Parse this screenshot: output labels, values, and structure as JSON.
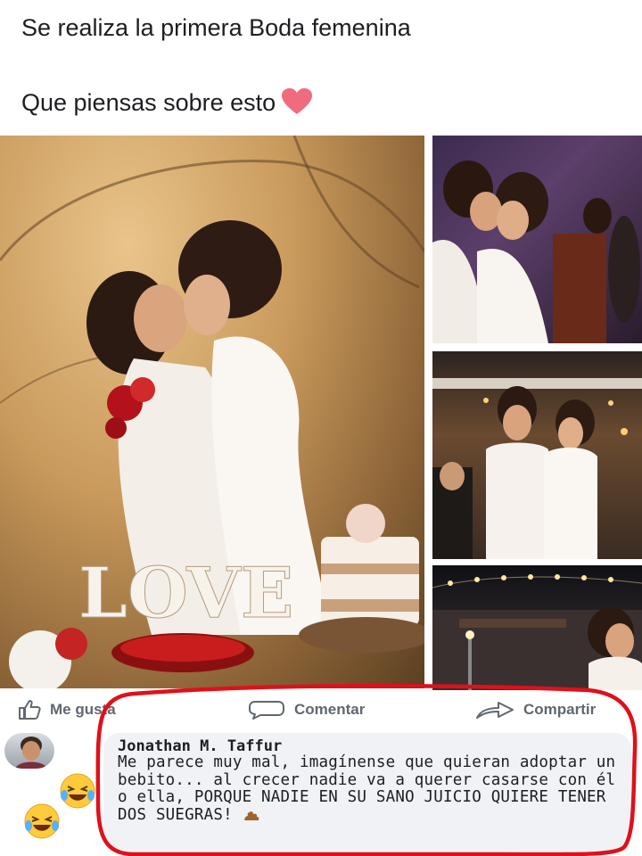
{
  "post": {
    "line1": "Se realiza la primera Boda femenina",
    "line2": "Que piensas sobre esto",
    "heart_icon": "heart-icon"
  },
  "photos": {
    "main_sign": "LOVE"
  },
  "actions": {
    "like_label": "Me gusta",
    "comment_label": "Comentar",
    "share_label": "Compartir"
  },
  "comment": {
    "author": "Jonathan M. Taffur",
    "text": "Me parece muy mal, imagínense que quieran adoptar un bebito... al crecer nadie va a querer casarse con él o ella, PORQUE NADIE EN SU SANO JUICIO QUIERE TENER DOS SUEGRAS!"
  },
  "colors": {
    "heart": "#f06b7e",
    "annotation_red": "#e0101a",
    "action_grey": "#606770",
    "bubble_bg": "#f0f2f5"
  }
}
